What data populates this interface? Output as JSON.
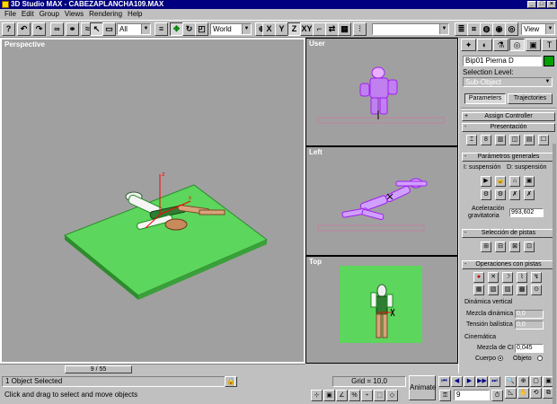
{
  "title": "3D Studio MAX - CABEZAPLANCHA109.MAX",
  "menu": [
    "File",
    "Edit",
    "Group",
    "Views",
    "Rendering",
    "Help"
  ],
  "toolbar": {
    "filter_value": "All",
    "coord_value": "World",
    "axis_x": "X",
    "axis_y": "Y",
    "axis_z": "Z",
    "axis_xy": "XY",
    "view_value": "View"
  },
  "viewports": {
    "perspective": "Perspective",
    "user": "User",
    "left": "Left",
    "top": "Top"
  },
  "timeline": {
    "frame_label": "9 / 55"
  },
  "status": {
    "selection": "1 Object Selected",
    "prompt": "Click and drag to select and move objects",
    "grid": "Grid = 10,0",
    "animate": "Animate",
    "current_frame": "9"
  },
  "command_panel": {
    "object_name": "Bip01 Pierna D",
    "object_color": "#00a000",
    "selection_level_label": "Selection Level:",
    "sub_object": "Sub-Object",
    "parameters_btn": "Parameters",
    "trajectories_btn": "Trajectories",
    "assign_controller": "Assign Controller",
    "presentacion": "Presentación",
    "parametros_generales": "Parámetros generales",
    "suspension_i": "I: suspensión",
    "suspension_d": "D: suspensión",
    "aceleracion_label1": "Aceleración",
    "aceleracion_label2": "gravitatoria",
    "aceleracion_value": "993,602",
    "seleccion_pistas": "Selección de pistas",
    "operaciones_pistas": "Operaciones con pistas",
    "dinamica_vertical": "Dinámica vertical",
    "mezcla_dinamica": "Mezcla dinámica",
    "mezcla_dinamica_value": "0,0",
    "tension_balistica": "Tensión balística",
    "tension_balistica_value": "0,0",
    "cinematica": "Cinemática",
    "mezcla_ci": "Mezcla de CI",
    "mezcla_ci_value": "0,045",
    "cuerpo": "Cuerpo",
    "objeto": "Objeto"
  },
  "colors": {
    "ground": "#5cd65c",
    "viewport_bg": "#a0a0a0",
    "titlebar": "#000080"
  }
}
